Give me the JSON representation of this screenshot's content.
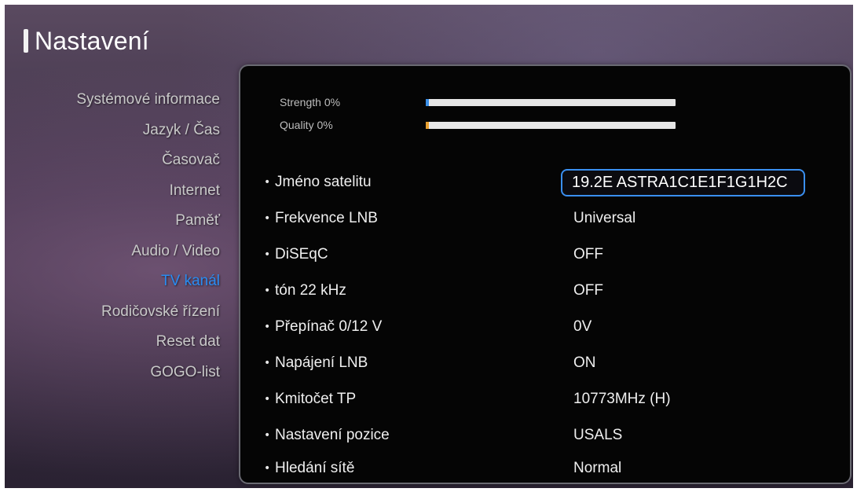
{
  "header": {
    "title": "Nastavení"
  },
  "sidebar": {
    "items": [
      {
        "label": "Systémové informace",
        "active": false
      },
      {
        "label": "Jazyk / Čas",
        "active": false
      },
      {
        "label": "Časovač",
        "active": false
      },
      {
        "label": "Internet",
        "active": false
      },
      {
        "label": "Paměť",
        "active": false
      },
      {
        "label": "Audio / Video",
        "active": false
      },
      {
        "label": "TV kanál",
        "active": true
      },
      {
        "label": "Rodičovské řízení",
        "active": false
      },
      {
        "label": "Reset dat",
        "active": false
      },
      {
        "label": "GOGO-list",
        "active": false
      }
    ],
    "active_color": "#2a8cf2"
  },
  "signal": {
    "strength": {
      "label": "Strength 0%",
      "value": 0,
      "color": "#3a8fe8"
    },
    "quality": {
      "label": "Quality 0%",
      "value": 0,
      "color": "#e8a030"
    }
  },
  "settings": [
    {
      "label": "Jméno satelitu",
      "value": "19.2E ASTRA1C1E1F1G1H2C",
      "focused": true
    },
    {
      "label": "Frekvence LNB",
      "value": "Universal",
      "focused": false
    },
    {
      "label": "DiSEqC",
      "value": "OFF",
      "focused": false
    },
    {
      "label": "tón 22 kHz",
      "value": "OFF",
      "focused": false
    },
    {
      "label": "Přepínač 0/12 V",
      "value": "0V",
      "focused": false
    },
    {
      "label": "Napájení LNB",
      "value": "ON",
      "focused": false
    },
    {
      "label": "Kmitočet TP",
      "value": "10773MHz (H)",
      "focused": false
    },
    {
      "label": "Nastavení pozice",
      "value": "USALS",
      "focused": false
    },
    {
      "label": "Hledání sítě",
      "value": "Normal",
      "focused": false
    }
  ],
  "colors": {
    "focus_border": "#3a8ff0"
  }
}
